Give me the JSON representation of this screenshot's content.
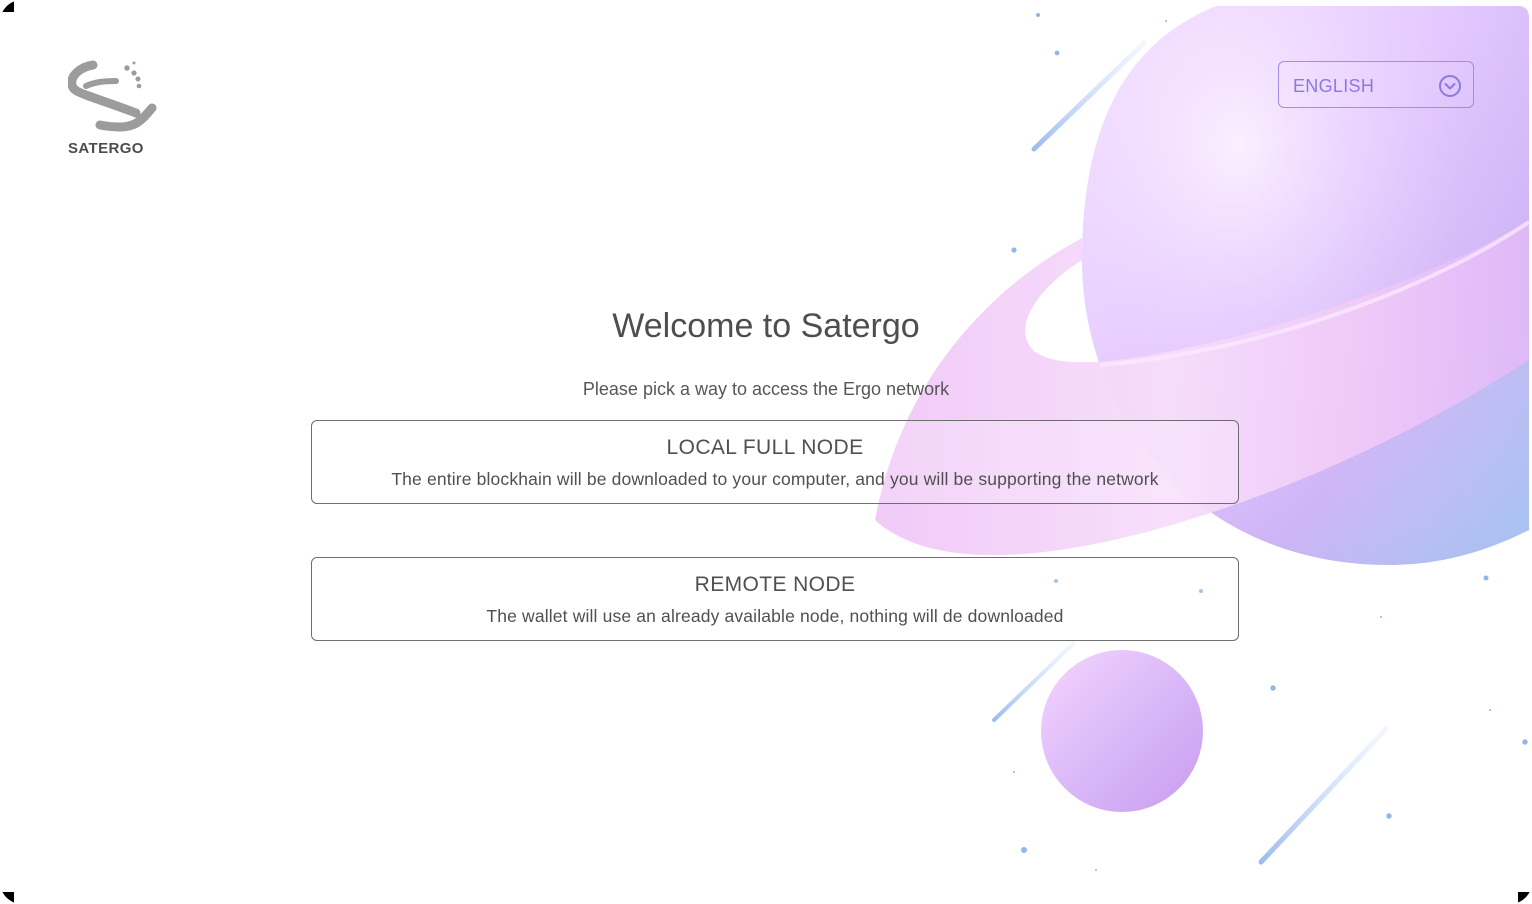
{
  "app": {
    "logo_text": "SATERGO"
  },
  "language": {
    "selected": "ENGLISH"
  },
  "welcome": {
    "title": "Welcome to Satergo",
    "subtitle": "Please pick a way to access the Ergo network"
  },
  "options": [
    {
      "title": "LOCAL FULL NODE",
      "description": "The entire blockhain will be downloaded to your computer, and you will be supporting the network"
    },
    {
      "title": "REMOTE NODE",
      "description": "The wallet will use an already available node, nothing will de downloaded"
    }
  ],
  "icons": {
    "language_dropdown": "chevron-down-circle-icon",
    "logo": "satergo-logo-icon"
  },
  "colors": {
    "accent": "#8b79e2",
    "text": "#4e4e4e",
    "border": "#6e6e6e"
  }
}
